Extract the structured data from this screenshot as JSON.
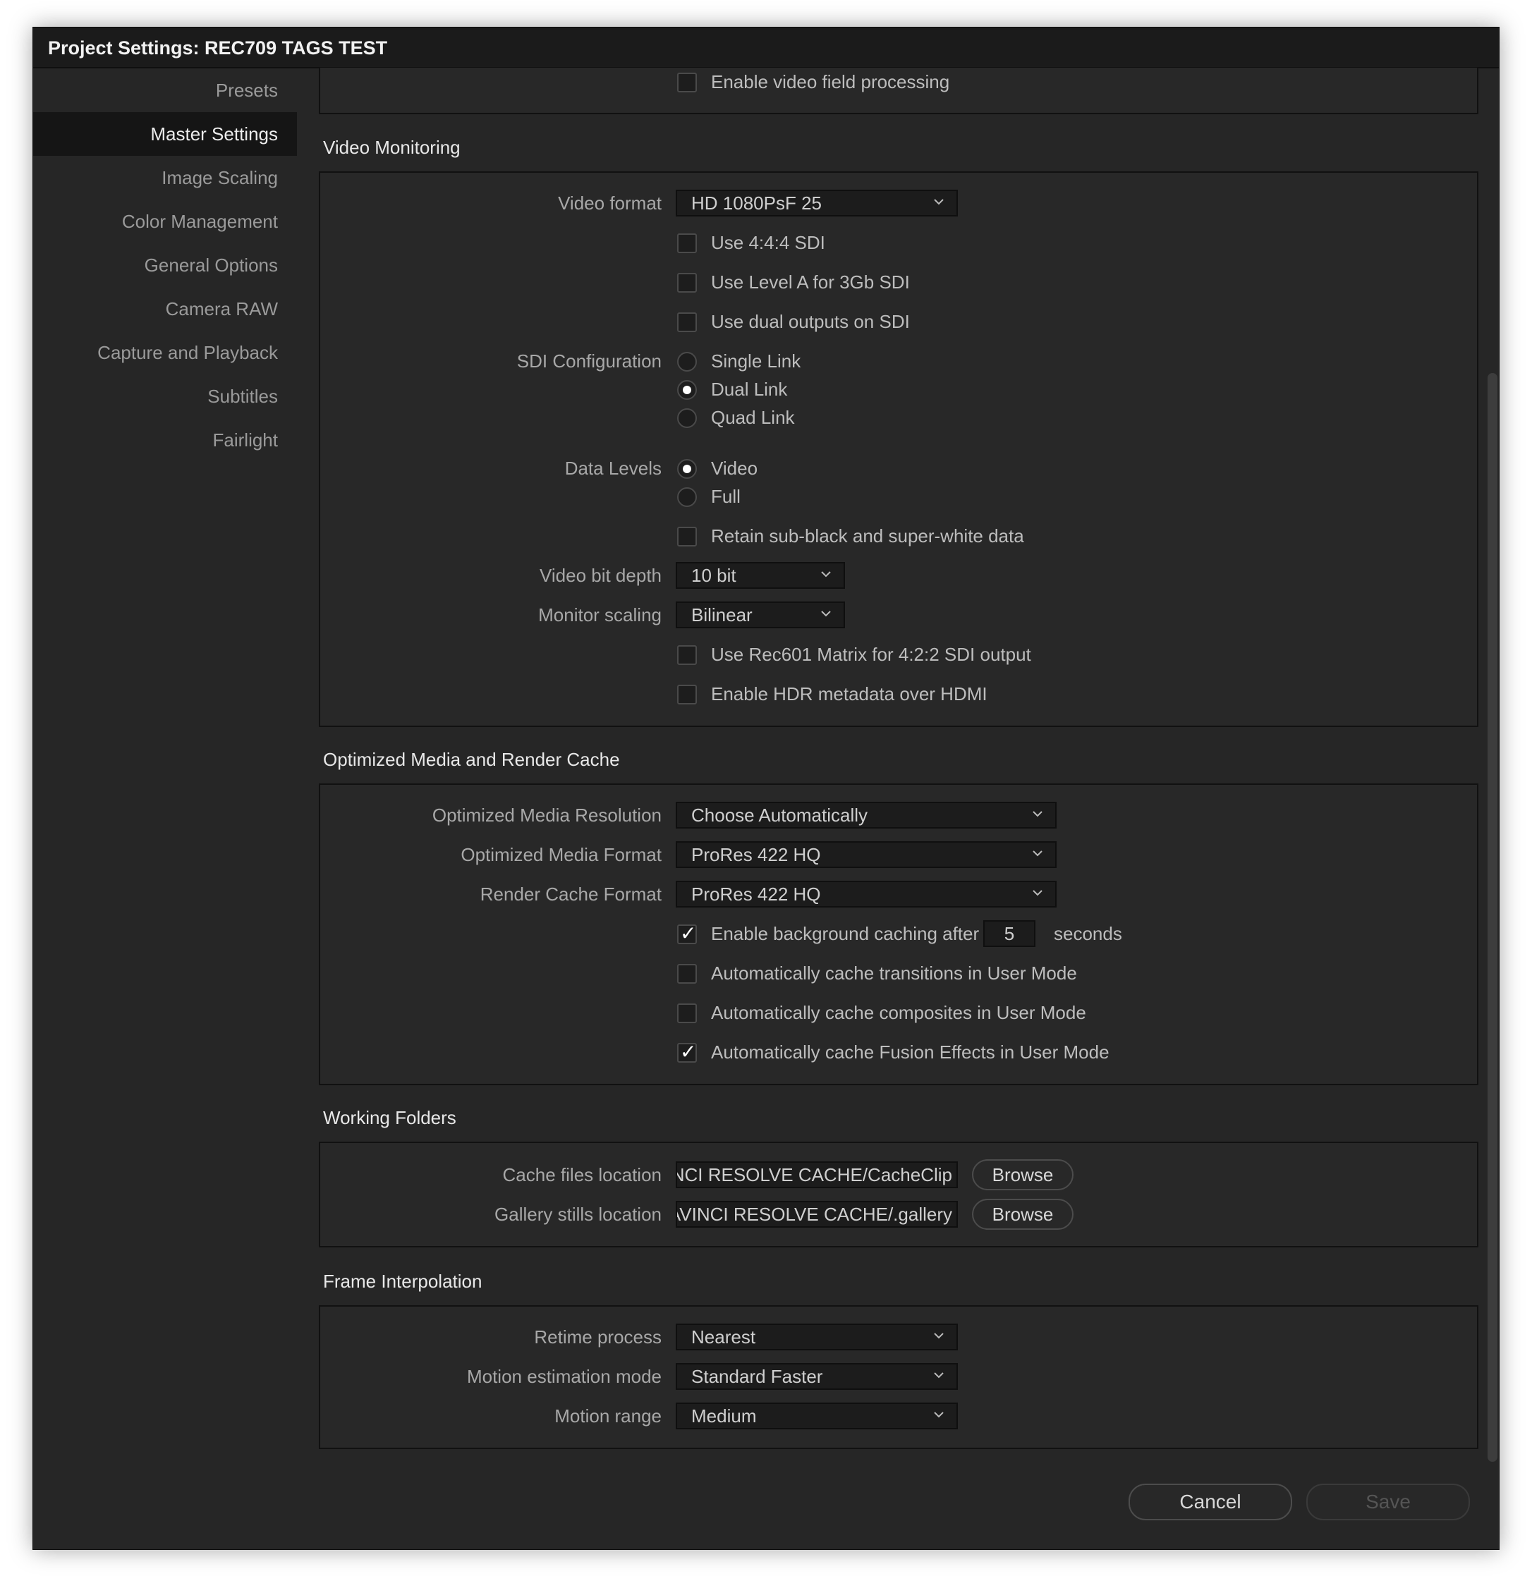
{
  "window": {
    "title": "Project Settings:  REC709 TAGS TEST"
  },
  "sidebar": {
    "items": [
      {
        "label": "Presets"
      },
      {
        "label": "Master Settings"
      },
      {
        "label": "Image Scaling"
      },
      {
        "label": "Color Management"
      },
      {
        "label": "General Options"
      },
      {
        "label": "Camera RAW"
      },
      {
        "label": "Capture and Playback"
      },
      {
        "label": "Subtitles"
      },
      {
        "label": "Fairlight"
      }
    ],
    "active": "Master Settings"
  },
  "top": {
    "field_processing": {
      "label": "Enable video field processing",
      "checked": false
    }
  },
  "video_monitoring": {
    "title": "Video Monitoring",
    "video_format": {
      "label": "Video format",
      "value": "HD 1080PsF 25"
    },
    "use_444": {
      "label": "Use 4:4:4 SDI",
      "checked": false
    },
    "level_a": {
      "label": "Use Level A for 3Gb SDI",
      "checked": false
    },
    "dual_outputs": {
      "label": "Use dual outputs on SDI",
      "checked": false
    },
    "sdi_config": {
      "label": "SDI Configuration",
      "options": [
        "Single Link",
        "Dual Link",
        "Quad Link"
      ],
      "selected": "Dual Link"
    },
    "data_levels": {
      "label": "Data Levels",
      "options": [
        "Video",
        "Full"
      ],
      "selected": "Video"
    },
    "retain": {
      "label": "Retain sub-black and super-white data",
      "checked": false
    },
    "bit_depth": {
      "label": "Video bit depth",
      "value": "10 bit"
    },
    "monitor_scaling": {
      "label": "Monitor scaling",
      "value": "Bilinear"
    },
    "rec601": {
      "label": "Use Rec601 Matrix for 4:2:2 SDI output",
      "checked": false
    },
    "hdr_meta": {
      "label": "Enable HDR metadata over HDMI",
      "checked": false
    }
  },
  "cache": {
    "title": "Optimized Media and Render Cache",
    "opt_res": {
      "label": "Optimized Media Resolution",
      "value": "Choose Automatically"
    },
    "opt_format": {
      "label": "Optimized Media Format",
      "value": "ProRes 422 HQ"
    },
    "render_format": {
      "label": "Render Cache Format",
      "value": "ProRes 422 HQ"
    },
    "bg_caching": {
      "label": "Enable background caching after",
      "value": "5",
      "unit": "seconds",
      "checked": true
    },
    "auto_transitions": {
      "label": "Automatically cache transitions in User Mode",
      "checked": false
    },
    "auto_composites": {
      "label": "Automatically cache composites in User Mode",
      "checked": false
    },
    "auto_fusion": {
      "label": "Automatically cache Fusion Effects in User Mode",
      "checked": true
    }
  },
  "folders": {
    "title": "Working Folders",
    "cache_loc": {
      "label": "Cache files location",
      "value": "/DAVINCI RESOLVE CACHE/CacheClip",
      "button": "Browse"
    },
    "gallery_loc": {
      "label": "Gallery stills location",
      "value": "D/DAVINCI RESOLVE CACHE/.gallery",
      "button": "Browse"
    }
  },
  "interp": {
    "title": "Frame Interpolation",
    "retime": {
      "label": "Retime process",
      "value": "Nearest"
    },
    "motion_mode": {
      "label": "Motion estimation mode",
      "value": "Standard Faster"
    },
    "motion_range": {
      "label": "Motion range",
      "value": "Medium"
    }
  },
  "footer": {
    "cancel": "Cancel",
    "save": "Save"
  },
  "colors": {
    "background": "#262626",
    "titlebar": "#1b1b1b",
    "panel": "#282828",
    "field": "#1c1c1c",
    "text": "#c8c8c8"
  }
}
